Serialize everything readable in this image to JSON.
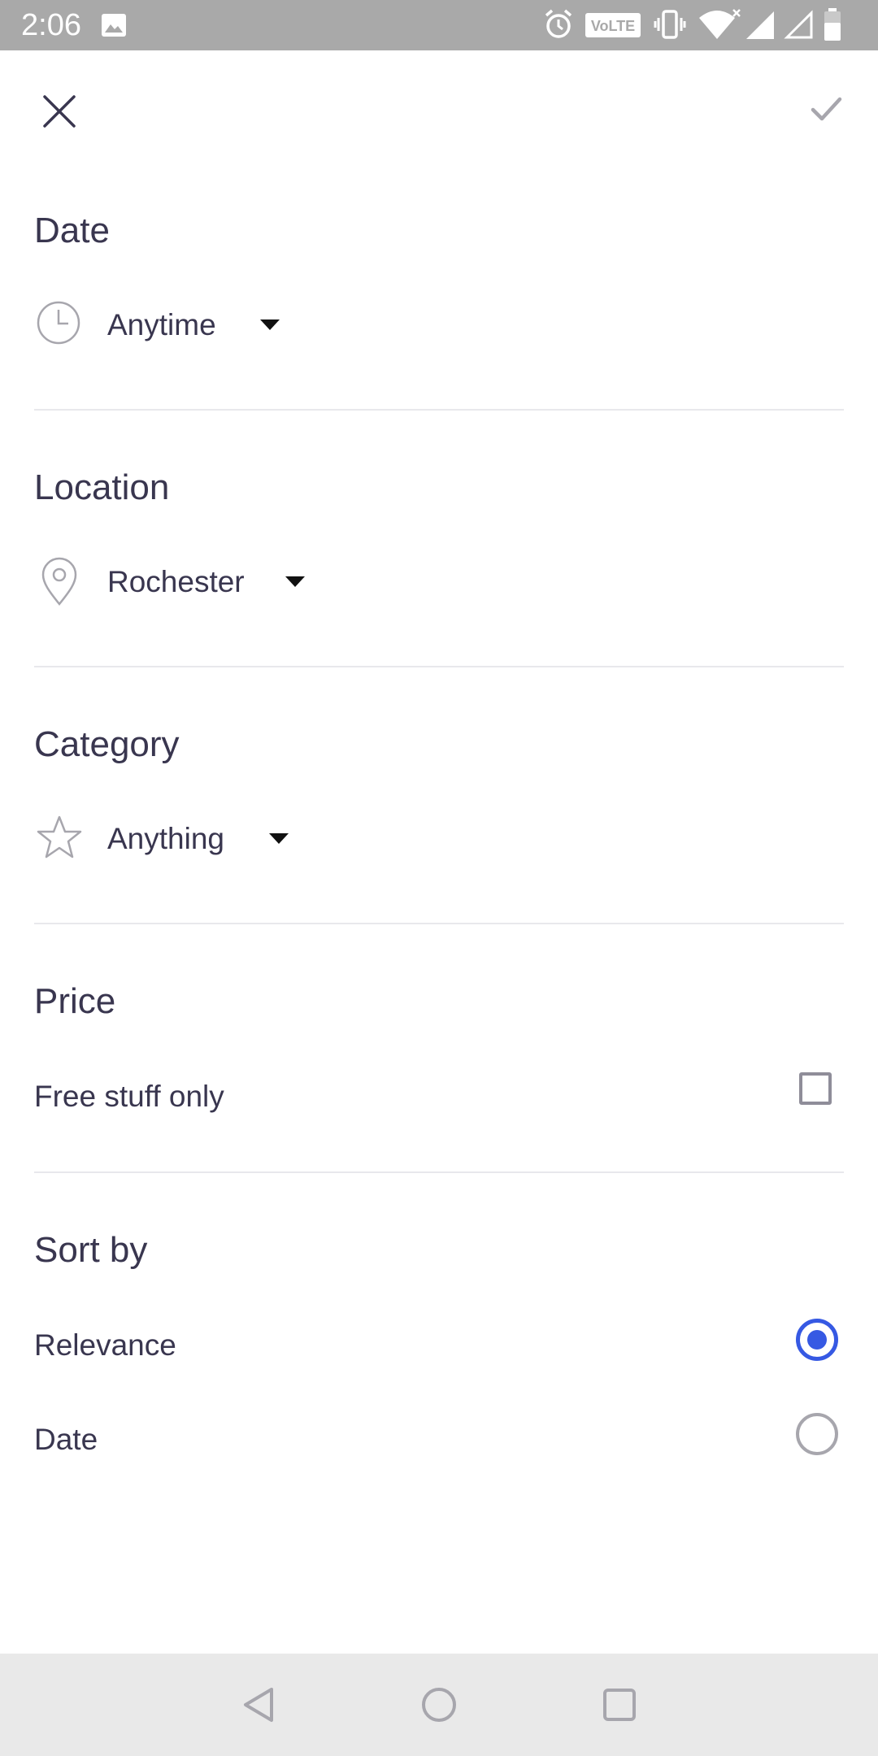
{
  "status_bar": {
    "time": "2:06",
    "icons": [
      "gallery-icon",
      "alarm-icon",
      "volte-icon",
      "vibrate-icon",
      "wifi-icon",
      "signal-icon",
      "signal-empty-icon",
      "battery-icon"
    ],
    "volte_text": "VoLTE"
  },
  "toolbar": {
    "close_icon": "close-icon",
    "confirm_icon": "check-icon"
  },
  "date_section": {
    "title": "Date",
    "icon": "clock-icon",
    "value": "Anytime"
  },
  "location_section": {
    "title": "Location",
    "icon": "map-pin-icon",
    "value": "Rochester"
  },
  "category_section": {
    "title": "Category",
    "icon": "star-icon",
    "value": "Anything"
  },
  "price_section": {
    "title": "Price",
    "free_label": "Free stuff only",
    "free_checked": false
  },
  "sort_section": {
    "title": "Sort by",
    "options": [
      {
        "label": "Relevance",
        "selected": true
      },
      {
        "label": "Date",
        "selected": false
      }
    ]
  },
  "colors": {
    "accent": "#3659e3",
    "text": "#39364f",
    "status_bar": "#a9a9a9",
    "nav_bar": "#e9e9e9"
  },
  "nav_bar": {
    "icons": [
      "back-icon",
      "home-icon",
      "recents-icon"
    ]
  }
}
